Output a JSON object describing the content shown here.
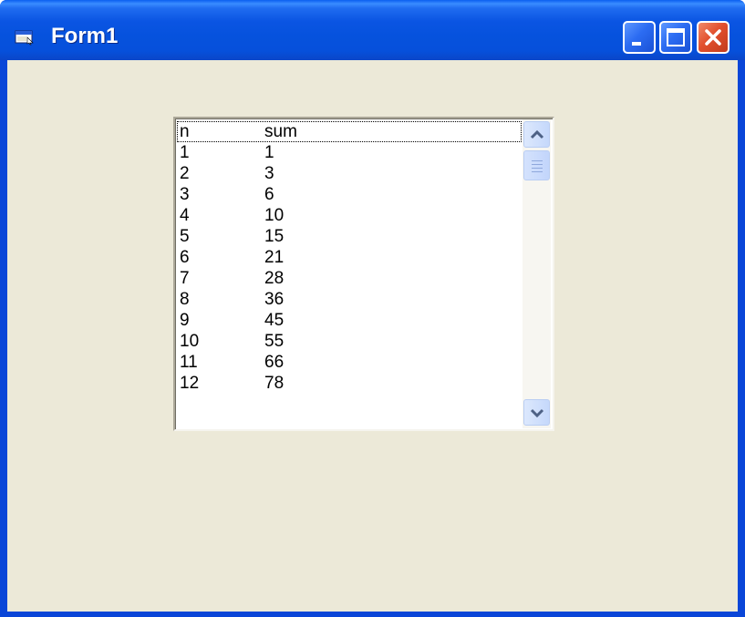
{
  "window": {
    "title": "Form1",
    "icon": "form-window-icon",
    "controls": [
      "minimize-icon",
      "maximize-icon",
      "close-icon"
    ]
  },
  "colors": {
    "titlebar": "#0652dd",
    "form_background": "#ece9d8",
    "list_background": "#ffffff",
    "close_button": "#e2502e"
  },
  "listbox": {
    "header": {
      "n": "n",
      "sum": "sum"
    },
    "rows": [
      {
        "n": "1",
        "sum": "1"
      },
      {
        "n": "2",
        "sum": "3"
      },
      {
        "n": "3",
        "sum": "6"
      },
      {
        "n": "4",
        "sum": "10"
      },
      {
        "n": "5",
        "sum": "15"
      },
      {
        "n": "6",
        "sum": "21"
      },
      {
        "n": "7",
        "sum": "28"
      },
      {
        "n": "8",
        "sum": "36"
      },
      {
        "n": "9",
        "sum": "45"
      },
      {
        "n": "10",
        "sum": "55"
      },
      {
        "n": "11",
        "sum": "66"
      },
      {
        "n": "12",
        "sum": "78"
      }
    ],
    "scrollbar_icons": [
      "chevron-up-icon",
      "chevron-down-icon"
    ]
  }
}
